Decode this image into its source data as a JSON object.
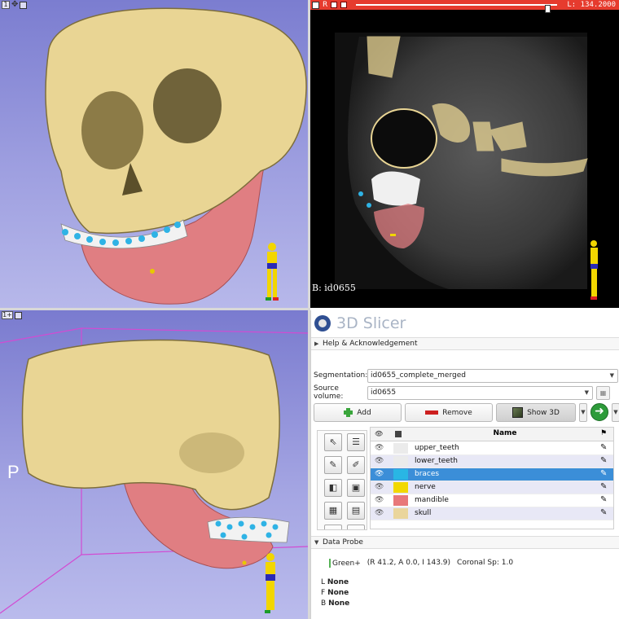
{
  "views": {
    "top_3d": {
      "number": "1",
      "orientation_label": ""
    },
    "slice": {
      "name_letter": "R",
      "offset_value": "L: 134.2000",
      "slider_value": 0.94,
      "volume_label": "B: id0655",
      "colors": {
        "bar": "#e63b2e"
      }
    },
    "bottom_3d": {
      "number": "1+",
      "orientation_label": "P"
    }
  },
  "app": {
    "title": "3D Slicer"
  },
  "help": {
    "label": "Help & Acknowledgement"
  },
  "segmentation": {
    "label": "Segmentation:",
    "value": "id0655_complete_merged"
  },
  "source_volume": {
    "label": "Source volume:",
    "value": "id0655"
  },
  "buttons": {
    "add": "Add",
    "remove": "Remove",
    "show3d": "Show 3D"
  },
  "table": {
    "name_header": "Name",
    "rows": [
      {
        "name": "upper_teeth",
        "color": "#ebebeb",
        "selected": false
      },
      {
        "name": "lower_teeth",
        "color": "#ebebeb",
        "selected": false
      },
      {
        "name": "braces",
        "color": "#29b6e4",
        "selected": true
      },
      {
        "name": "nerve",
        "color": "#f2d800",
        "selected": false
      },
      {
        "name": "mandible",
        "color": "#e8787a",
        "selected": false
      },
      {
        "name": "skull",
        "color": "#ead59c",
        "selected": false
      }
    ]
  },
  "data_probe": {
    "label": "Data Probe",
    "view": "Green+",
    "position": "(R 41.2, A 0.0, I 143.9)",
    "spacing": "Coronal Sp: 1.0",
    "layers": [
      {
        "letter": "L",
        "value": "None"
      },
      {
        "letter": "F",
        "value": "None"
      },
      {
        "letter": "B",
        "value": "None"
      }
    ]
  },
  "colors": {
    "skull": "#e9d594",
    "mandible": "#e07e82",
    "braces": "#2fb3e5",
    "teeth": "#f2f2f2",
    "selection": "#3b8ed8"
  }
}
